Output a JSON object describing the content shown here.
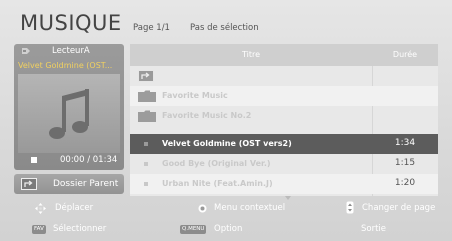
{
  "header": {
    "title": "MUSIQUE",
    "page_indicator": "Page 1/1",
    "selection_status": "Pas de sélection"
  },
  "player": {
    "icon": "device-icon",
    "device_name": "LecteurA",
    "now_playing": "Velvet Goldmine (OST...",
    "art_icon": "music-note-icon",
    "time": "00:00 / 01:34"
  },
  "parent_button": {
    "icon": "folder-up-icon",
    "label": "Dossier Parent"
  },
  "list": {
    "columns": {
      "title": "Titre",
      "duration": "Durée"
    },
    "rows": [
      {
        "type": "up",
        "icon": "folder-up-icon",
        "title": "",
        "duration": ""
      },
      {
        "type": "folder",
        "icon": "folder-icon",
        "title": "Favorite Music",
        "duration": ""
      },
      {
        "type": "folder",
        "icon": "folder-icon",
        "title": "Favorite Music No.2",
        "duration": ""
      },
      {
        "type": "track",
        "selected": true,
        "title": "Velvet Goldmine (OST vers2)",
        "duration": "1:34"
      },
      {
        "type": "track",
        "title": "Good Bye (Original Ver.)",
        "duration": "1:15"
      },
      {
        "type": "track",
        "title": "Urban Nite (Feat.Amin.J)",
        "duration": "1:20"
      }
    ]
  },
  "footer": {
    "move": {
      "icon": "dpad-icon",
      "label": "Déplacer"
    },
    "context": {
      "icon": "ok-button-icon",
      "label": "Menu contextuel"
    },
    "page": {
      "icon": "page-rocker-icon",
      "label": "Changer de page"
    },
    "select": {
      "key": "FAV",
      "label": "Sélectionner"
    },
    "option": {
      "key": "Q.MENU",
      "label": "Option"
    },
    "exit": {
      "label": "Sortie"
    }
  },
  "colors": {
    "panel": "#8f8f8f",
    "selected_row": "#5c5c5c",
    "now_playing_text": "#f0d060"
  }
}
